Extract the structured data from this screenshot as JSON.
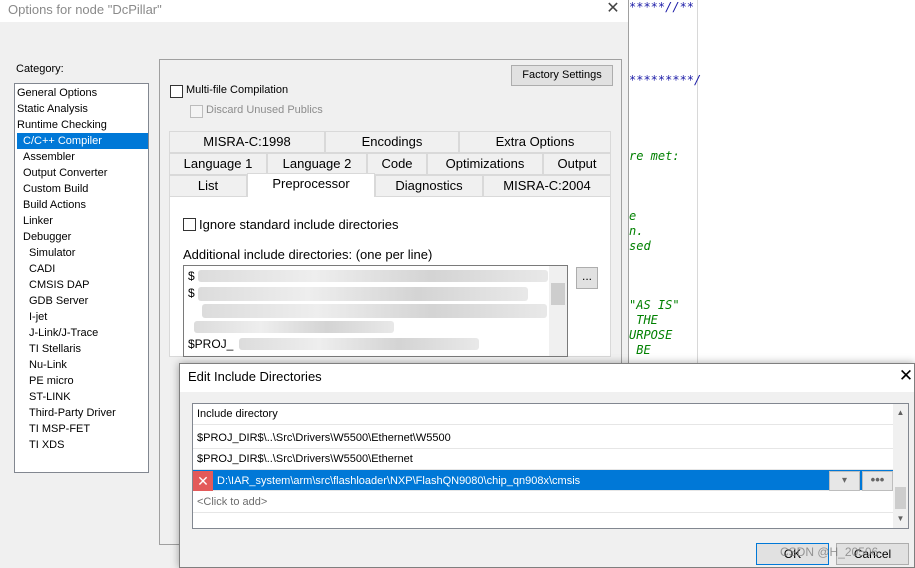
{
  "options_window": {
    "title": "Options for node \"DcPillar\"",
    "close_glyph": "✕",
    "category_label": "Category:",
    "categories": [
      "General Options",
      "Static Analysis",
      "Runtime Checking",
      "C/C++ Compiler",
      "Assembler",
      "Output Converter",
      "Custom Build",
      "Build Actions",
      "Linker",
      "Debugger",
      "Simulator",
      "CADI",
      "CMSIS DAP",
      "GDB Server",
      "I-jet",
      "J-Link/J-Trace",
      "TI Stellaris",
      "Nu-Link",
      "PE micro",
      "ST-LINK",
      "Third-Party Driver",
      "TI MSP-FET",
      "TI XDS"
    ],
    "selected_category": "C/C++ Compiler",
    "multi_file_compilation": "Multi-file Compilation",
    "discard_unused_publics": "Discard Unused Publics",
    "factory_settings": "Factory Settings",
    "tabs_row1": [
      "MISRA-C:1998",
      "Encodings",
      "Extra Options"
    ],
    "tabs_row2": [
      "Language 1",
      "Language 2",
      "Code",
      "Optimizations",
      "Output"
    ],
    "tabs_row3": [
      "List",
      "Preprocessor",
      "Diagnostics",
      "MISRA-C:2004"
    ],
    "active_tab": "Preprocessor",
    "ignore_std_include": "Ignore standard include directories",
    "additional_include_label": "Additional include directories: (one per line)",
    "include_lines_visible": [
      "$",
      "$",
      "$PROJ_"
    ],
    "browse_label": "..."
  },
  "editor": {
    "lines": [
      {
        "text": "*****//**",
        "color": "#1a1aa6"
      },
      {
        "text": "*********/",
        "color": "#1a1aa6"
      },
      {
        "text": "re met:",
        "color": "#008000"
      },
      {
        "text": "e",
        "color": "#008000"
      },
      {
        "text": "n.",
        "color": "#008000"
      },
      {
        "text": "sed",
        "color": "#008000"
      },
      {
        "text": "\"AS IS\"",
        "color": "#008000"
      },
      {
        "text": " THE",
        "color": "#008000"
      },
      {
        "text": "URPOSE",
        "color": "#008000"
      },
      {
        "text": " BE",
        "color": "#008000"
      }
    ]
  },
  "edit_dialog": {
    "title": "Edit Include Directories",
    "close_glyph": "✕",
    "column_header": "Include directory",
    "rows": [
      "$PROJ_DIR$\\..\\Src\\Drivers\\W5500\\Ethernet\\W5500",
      "$PROJ_DIR$\\..\\Src\\Drivers\\W5500\\Ethernet"
    ],
    "selected_row": "D:\\IAR_system\\arm\\src\\flashloader\\NXP\\FlashQN9080\\chip_qn908x\\cmsis",
    "remove_glyph": "✕",
    "dropdown_glyph": "▾",
    "ellipsis_glyph": "•••",
    "click_to_add": "<Click to add>",
    "ok": "OK",
    "cancel": "Cancel",
    "watermark": "CSDN @H_20506"
  }
}
